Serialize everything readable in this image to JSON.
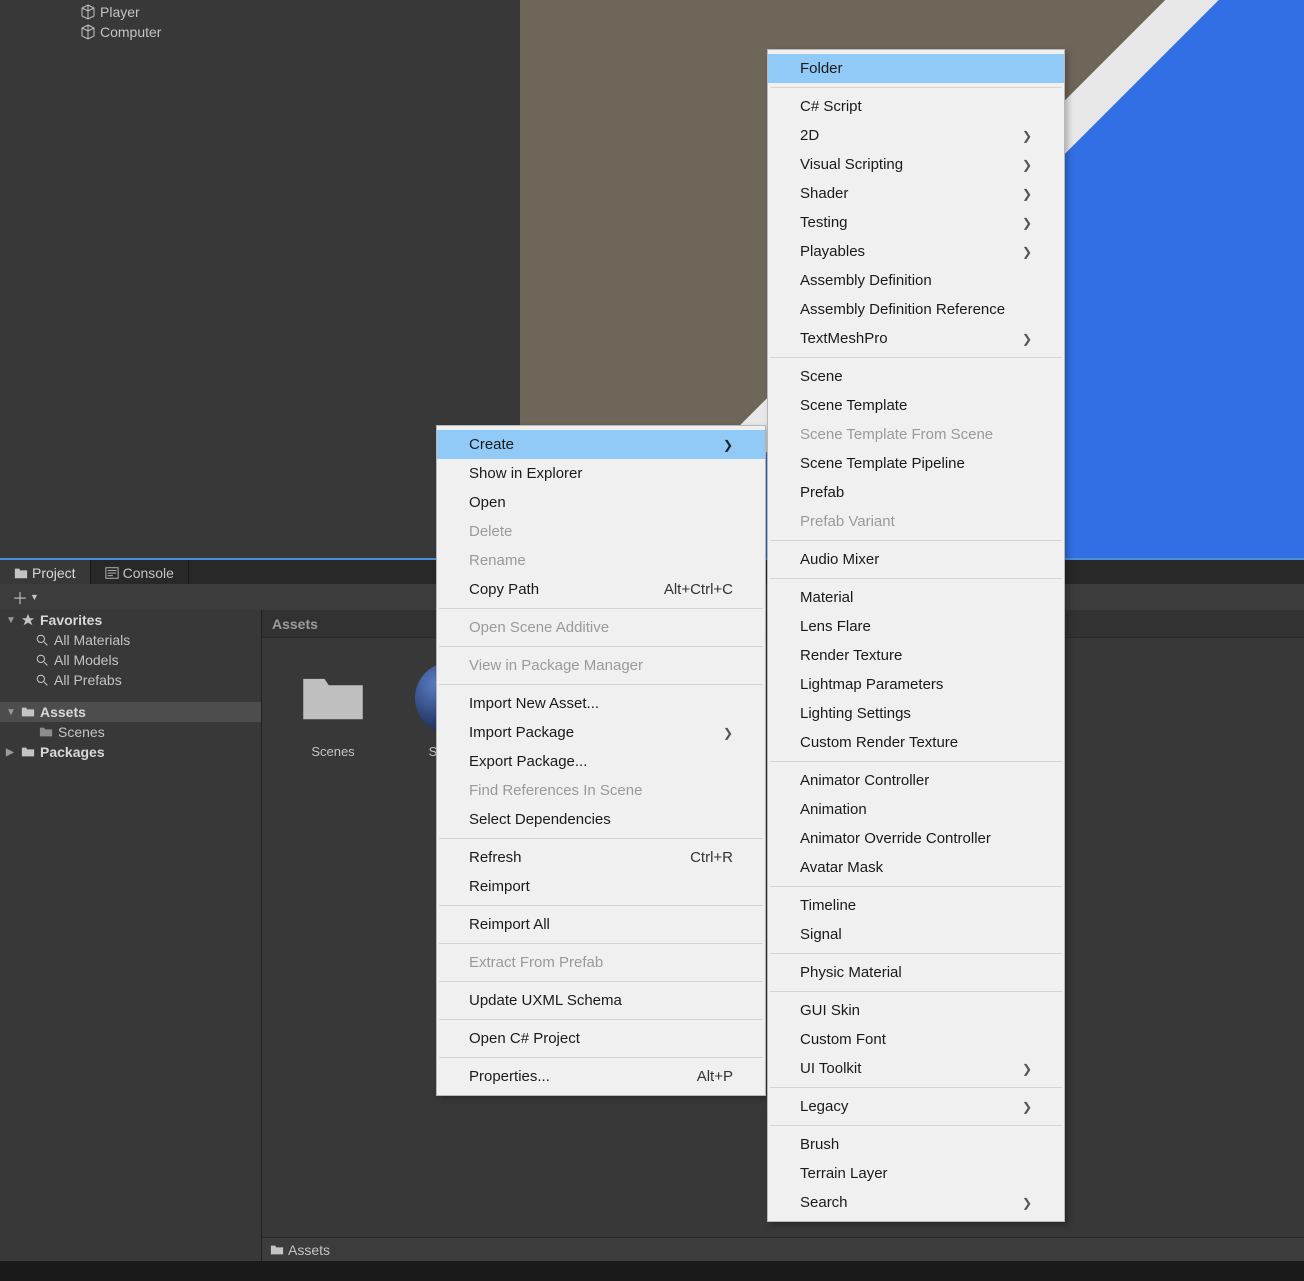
{
  "hierarchy": {
    "items": [
      {
        "label": "Player"
      },
      {
        "label": "Computer"
      }
    ]
  },
  "tabs": {
    "project": "Project",
    "console": "Console"
  },
  "project": {
    "favorites": {
      "label": "Favorites",
      "items": [
        "All Materials",
        "All Models",
        "All Prefabs"
      ]
    },
    "assets": {
      "label": "Assets",
      "items": [
        "Scenes"
      ]
    },
    "packages": {
      "label": "Packages"
    },
    "grid_header": "Assets",
    "grid": [
      {
        "label": "Scenes",
        "type": "folder"
      },
      {
        "label": "Sol_Ble",
        "type": "sphere"
      }
    ],
    "footer": "Assets"
  },
  "menu1": [
    {
      "label": "Create",
      "type": "submenu",
      "highlight": true
    },
    {
      "label": "Show in Explorer"
    },
    {
      "label": "Open"
    },
    {
      "label": "Delete",
      "disabled": true
    },
    {
      "label": "Rename",
      "disabled": true
    },
    {
      "label": "Copy Path",
      "shortcut": "Alt+Ctrl+C"
    },
    {
      "type": "sep"
    },
    {
      "label": "Open Scene Additive",
      "disabled": true
    },
    {
      "type": "sep"
    },
    {
      "label": "View in Package Manager",
      "disabled": true
    },
    {
      "type": "sep"
    },
    {
      "label": "Import New Asset..."
    },
    {
      "label": "Import Package",
      "type": "submenu"
    },
    {
      "label": "Export Package..."
    },
    {
      "label": "Find References In Scene",
      "disabled": true
    },
    {
      "label": "Select Dependencies"
    },
    {
      "type": "sep"
    },
    {
      "label": "Refresh",
      "shortcut": "Ctrl+R"
    },
    {
      "label": "Reimport"
    },
    {
      "type": "sep"
    },
    {
      "label": "Reimport All"
    },
    {
      "type": "sep"
    },
    {
      "label": "Extract From Prefab",
      "disabled": true
    },
    {
      "type": "sep"
    },
    {
      "label": "Update UXML Schema"
    },
    {
      "type": "sep"
    },
    {
      "label": "Open C# Project"
    },
    {
      "type": "sep"
    },
    {
      "label": "Properties...",
      "shortcut": "Alt+P"
    }
  ],
  "menu2": [
    {
      "label": "Folder",
      "highlight": true
    },
    {
      "type": "sep"
    },
    {
      "label": "C# Script"
    },
    {
      "label": "2D",
      "type": "submenu"
    },
    {
      "label": "Visual Scripting",
      "type": "submenu"
    },
    {
      "label": "Shader",
      "type": "submenu"
    },
    {
      "label": "Testing",
      "type": "submenu"
    },
    {
      "label": "Playables",
      "type": "submenu"
    },
    {
      "label": "Assembly Definition"
    },
    {
      "label": "Assembly Definition Reference"
    },
    {
      "label": "TextMeshPro",
      "type": "submenu"
    },
    {
      "type": "sep"
    },
    {
      "label": "Scene"
    },
    {
      "label": "Scene Template"
    },
    {
      "label": "Scene Template From Scene",
      "disabled": true
    },
    {
      "label": "Scene Template Pipeline"
    },
    {
      "label": "Prefab"
    },
    {
      "label": "Prefab Variant",
      "disabled": true
    },
    {
      "type": "sep"
    },
    {
      "label": "Audio Mixer"
    },
    {
      "type": "sep"
    },
    {
      "label": "Material"
    },
    {
      "label": "Lens Flare"
    },
    {
      "label": "Render Texture"
    },
    {
      "label": "Lightmap Parameters"
    },
    {
      "label": "Lighting Settings"
    },
    {
      "label": "Custom Render Texture"
    },
    {
      "type": "sep"
    },
    {
      "label": "Animator Controller"
    },
    {
      "label": "Animation"
    },
    {
      "label": "Animator Override Controller"
    },
    {
      "label": "Avatar Mask"
    },
    {
      "type": "sep"
    },
    {
      "label": "Timeline"
    },
    {
      "label": "Signal"
    },
    {
      "type": "sep"
    },
    {
      "label": "Physic Material"
    },
    {
      "type": "sep"
    },
    {
      "label": "GUI Skin"
    },
    {
      "label": "Custom Font"
    },
    {
      "label": "UI Toolkit",
      "type": "submenu"
    },
    {
      "type": "sep"
    },
    {
      "label": "Legacy",
      "type": "submenu"
    },
    {
      "type": "sep"
    },
    {
      "label": "Brush"
    },
    {
      "label": "Terrain Layer"
    },
    {
      "label": "Search",
      "type": "submenu"
    }
  ]
}
